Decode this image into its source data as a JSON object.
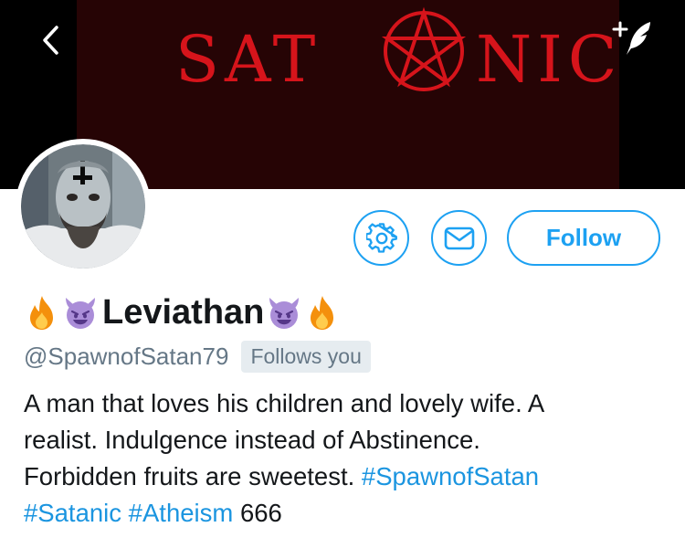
{
  "banner": {
    "title_left": "SAT",
    "title_right": "NIC",
    "background_color": "#260405",
    "text_color": "#d6141b"
  },
  "nav": {
    "back_icon": "chevron-left-icon",
    "compose_icon": "compose-quill-icon"
  },
  "profile_actions": {
    "settings_icon": "gear-icon",
    "message_icon": "envelope-icon",
    "follow_label": "Follow",
    "accent_color": "#1da1f2"
  },
  "profile": {
    "display_name": "Leviathan",
    "name_emojis": [
      "fire-icon",
      "smiling-devil-icon",
      "smiling-devil-icon",
      "fire-icon"
    ],
    "handle": "@SpawnofSatan79",
    "follows_you": "Follows you",
    "bio": {
      "line1": "A man that loves his children and lovely wife. A",
      "line2": "realist. Indulgence instead of Abstinence.",
      "line3_text": "Forbidden fruits are sweetest.",
      "hashtag1": "#SpawnofSatan",
      "hashtag2": "#Satanic",
      "hashtag3": "#Atheism",
      "trailing_text": "666"
    }
  }
}
